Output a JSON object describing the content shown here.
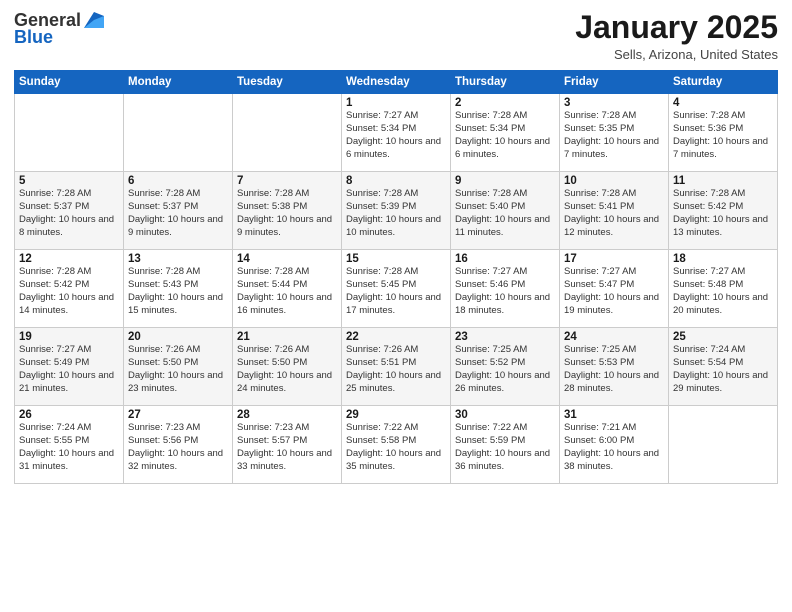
{
  "logo": {
    "general": "General",
    "blue": "Blue"
  },
  "title": "January 2025",
  "location": "Sells, Arizona, United States",
  "days_of_week": [
    "Sunday",
    "Monday",
    "Tuesday",
    "Wednesday",
    "Thursday",
    "Friday",
    "Saturday"
  ],
  "weeks": [
    [
      {
        "num": "",
        "sunrise": "",
        "sunset": "",
        "daylight": ""
      },
      {
        "num": "",
        "sunrise": "",
        "sunset": "",
        "daylight": ""
      },
      {
        "num": "",
        "sunrise": "",
        "sunset": "",
        "daylight": ""
      },
      {
        "num": "1",
        "sunrise": "Sunrise: 7:27 AM",
        "sunset": "Sunset: 5:34 PM",
        "daylight": "Daylight: 10 hours and 6 minutes."
      },
      {
        "num": "2",
        "sunrise": "Sunrise: 7:28 AM",
        "sunset": "Sunset: 5:34 PM",
        "daylight": "Daylight: 10 hours and 6 minutes."
      },
      {
        "num": "3",
        "sunrise": "Sunrise: 7:28 AM",
        "sunset": "Sunset: 5:35 PM",
        "daylight": "Daylight: 10 hours and 7 minutes."
      },
      {
        "num": "4",
        "sunrise": "Sunrise: 7:28 AM",
        "sunset": "Sunset: 5:36 PM",
        "daylight": "Daylight: 10 hours and 7 minutes."
      }
    ],
    [
      {
        "num": "5",
        "sunrise": "Sunrise: 7:28 AM",
        "sunset": "Sunset: 5:37 PM",
        "daylight": "Daylight: 10 hours and 8 minutes."
      },
      {
        "num": "6",
        "sunrise": "Sunrise: 7:28 AM",
        "sunset": "Sunset: 5:37 PM",
        "daylight": "Daylight: 10 hours and 9 minutes."
      },
      {
        "num": "7",
        "sunrise": "Sunrise: 7:28 AM",
        "sunset": "Sunset: 5:38 PM",
        "daylight": "Daylight: 10 hours and 9 minutes."
      },
      {
        "num": "8",
        "sunrise": "Sunrise: 7:28 AM",
        "sunset": "Sunset: 5:39 PM",
        "daylight": "Daylight: 10 hours and 10 minutes."
      },
      {
        "num": "9",
        "sunrise": "Sunrise: 7:28 AM",
        "sunset": "Sunset: 5:40 PM",
        "daylight": "Daylight: 10 hours and 11 minutes."
      },
      {
        "num": "10",
        "sunrise": "Sunrise: 7:28 AM",
        "sunset": "Sunset: 5:41 PM",
        "daylight": "Daylight: 10 hours and 12 minutes."
      },
      {
        "num": "11",
        "sunrise": "Sunrise: 7:28 AM",
        "sunset": "Sunset: 5:42 PM",
        "daylight": "Daylight: 10 hours and 13 minutes."
      }
    ],
    [
      {
        "num": "12",
        "sunrise": "Sunrise: 7:28 AM",
        "sunset": "Sunset: 5:42 PM",
        "daylight": "Daylight: 10 hours and 14 minutes."
      },
      {
        "num": "13",
        "sunrise": "Sunrise: 7:28 AM",
        "sunset": "Sunset: 5:43 PM",
        "daylight": "Daylight: 10 hours and 15 minutes."
      },
      {
        "num": "14",
        "sunrise": "Sunrise: 7:28 AM",
        "sunset": "Sunset: 5:44 PM",
        "daylight": "Daylight: 10 hours and 16 minutes."
      },
      {
        "num": "15",
        "sunrise": "Sunrise: 7:28 AM",
        "sunset": "Sunset: 5:45 PM",
        "daylight": "Daylight: 10 hours and 17 minutes."
      },
      {
        "num": "16",
        "sunrise": "Sunrise: 7:27 AM",
        "sunset": "Sunset: 5:46 PM",
        "daylight": "Daylight: 10 hours and 18 minutes."
      },
      {
        "num": "17",
        "sunrise": "Sunrise: 7:27 AM",
        "sunset": "Sunset: 5:47 PM",
        "daylight": "Daylight: 10 hours and 19 minutes."
      },
      {
        "num": "18",
        "sunrise": "Sunrise: 7:27 AM",
        "sunset": "Sunset: 5:48 PM",
        "daylight": "Daylight: 10 hours and 20 minutes."
      }
    ],
    [
      {
        "num": "19",
        "sunrise": "Sunrise: 7:27 AM",
        "sunset": "Sunset: 5:49 PM",
        "daylight": "Daylight: 10 hours and 21 minutes."
      },
      {
        "num": "20",
        "sunrise": "Sunrise: 7:26 AM",
        "sunset": "Sunset: 5:50 PM",
        "daylight": "Daylight: 10 hours and 23 minutes."
      },
      {
        "num": "21",
        "sunrise": "Sunrise: 7:26 AM",
        "sunset": "Sunset: 5:50 PM",
        "daylight": "Daylight: 10 hours and 24 minutes."
      },
      {
        "num": "22",
        "sunrise": "Sunrise: 7:26 AM",
        "sunset": "Sunset: 5:51 PM",
        "daylight": "Daylight: 10 hours and 25 minutes."
      },
      {
        "num": "23",
        "sunrise": "Sunrise: 7:25 AM",
        "sunset": "Sunset: 5:52 PM",
        "daylight": "Daylight: 10 hours and 26 minutes."
      },
      {
        "num": "24",
        "sunrise": "Sunrise: 7:25 AM",
        "sunset": "Sunset: 5:53 PM",
        "daylight": "Daylight: 10 hours and 28 minutes."
      },
      {
        "num": "25",
        "sunrise": "Sunrise: 7:24 AM",
        "sunset": "Sunset: 5:54 PM",
        "daylight": "Daylight: 10 hours and 29 minutes."
      }
    ],
    [
      {
        "num": "26",
        "sunrise": "Sunrise: 7:24 AM",
        "sunset": "Sunset: 5:55 PM",
        "daylight": "Daylight: 10 hours and 31 minutes."
      },
      {
        "num": "27",
        "sunrise": "Sunrise: 7:23 AM",
        "sunset": "Sunset: 5:56 PM",
        "daylight": "Daylight: 10 hours and 32 minutes."
      },
      {
        "num": "28",
        "sunrise": "Sunrise: 7:23 AM",
        "sunset": "Sunset: 5:57 PM",
        "daylight": "Daylight: 10 hours and 33 minutes."
      },
      {
        "num": "29",
        "sunrise": "Sunrise: 7:22 AM",
        "sunset": "Sunset: 5:58 PM",
        "daylight": "Daylight: 10 hours and 35 minutes."
      },
      {
        "num": "30",
        "sunrise": "Sunrise: 7:22 AM",
        "sunset": "Sunset: 5:59 PM",
        "daylight": "Daylight: 10 hours and 36 minutes."
      },
      {
        "num": "31",
        "sunrise": "Sunrise: 7:21 AM",
        "sunset": "Sunset: 6:00 PM",
        "daylight": "Daylight: 10 hours and 38 minutes."
      },
      {
        "num": "",
        "sunrise": "",
        "sunset": "",
        "daylight": ""
      }
    ]
  ]
}
